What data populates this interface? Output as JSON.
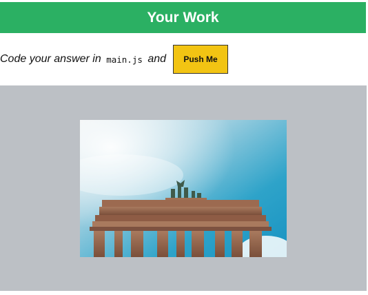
{
  "header": {
    "title": "Your Work"
  },
  "instructions": {
    "prefix": "Code your answer in ",
    "filename": "main.js",
    "suffix": " and"
  },
  "toolbar": {
    "push_label": "Push Me"
  },
  "image": {
    "subject": "brandenburg-gate-photo"
  },
  "colors": {
    "header_bg": "#2bb063",
    "button_bg": "#f2c413",
    "stage_bg": "#bcc0c5"
  }
}
